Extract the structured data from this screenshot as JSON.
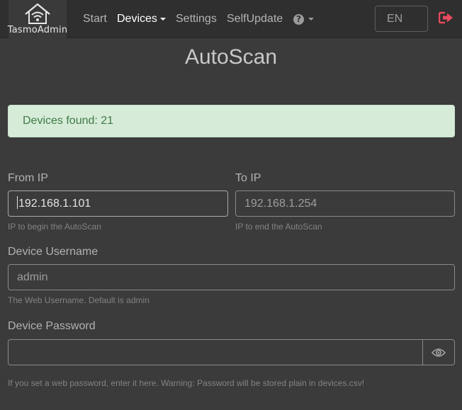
{
  "navbar": {
    "brand": "TasmoAdmin",
    "items": [
      "Start",
      "Devices",
      "Settings",
      "SelfUpdate"
    ],
    "language": "EN"
  },
  "page": {
    "title": "AutoScan"
  },
  "alert": {
    "text": "Devices found: 21"
  },
  "form": {
    "from_ip": {
      "label": "From IP",
      "value": "192.168.1.101",
      "help": "IP to begin the AutoScan"
    },
    "to_ip": {
      "label": "To IP",
      "placeholder": "192.168.1.254",
      "help": "IP to end the AutoScan"
    },
    "username": {
      "label": "Device Username",
      "placeholder": "admin",
      "help": "The Web Username. Default is admin"
    },
    "password": {
      "label": "Device Password",
      "value": "",
      "help": "If you set a web password, enter it here. Warning: Password will be stored plain in devices.csv!"
    }
  },
  "colors": {
    "background": "#3b3b3b",
    "navbar": "#2f2f2f",
    "alert_bg": "#d6ecd9",
    "alert_text": "#3f7a44",
    "logout": "#e84a5f"
  },
  "icons": {
    "brand": "home-wifi-icon",
    "help": "question-circle-icon",
    "logout": "sign-out-icon",
    "show_password": "eye-icon"
  }
}
